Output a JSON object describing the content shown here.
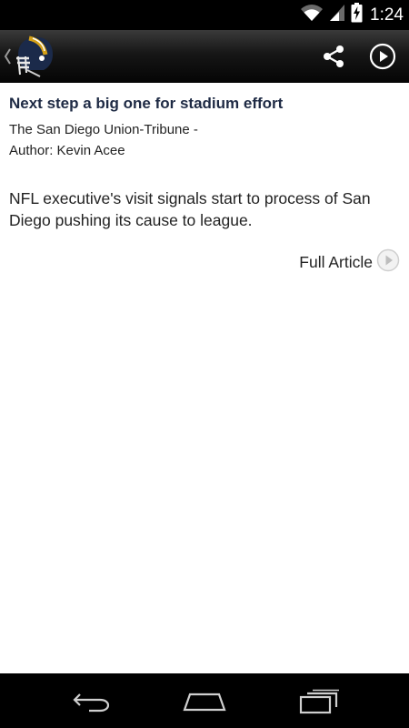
{
  "status_bar": {
    "time": "1:24",
    "icons": [
      "wifi-icon",
      "cell-signal-icon",
      "battery-charging-icon"
    ]
  },
  "action_bar": {
    "up_icon": "chevron-left-icon",
    "logo_icon": "football-helmet-icon",
    "actions": [
      "share-icon",
      "play-circle-icon"
    ]
  },
  "article": {
    "title": "Next step a big one for stadium effort",
    "source": "The San Diego Union-Tribune -",
    "author": "Author: Kevin Acee",
    "summary": "NFL executive's visit signals start to process of San Diego pushing its cause to league.",
    "full_article_label": "Full Article",
    "full_article_icon": "play-circle-icon"
  },
  "nav_bar": {
    "buttons": [
      "back-icon",
      "home-icon",
      "recents-icon"
    ]
  },
  "colors": {
    "title": "#1e2a44",
    "text": "#222222",
    "helmet_gold": "#d4a017",
    "helmet_navy": "#1b2a4a"
  }
}
